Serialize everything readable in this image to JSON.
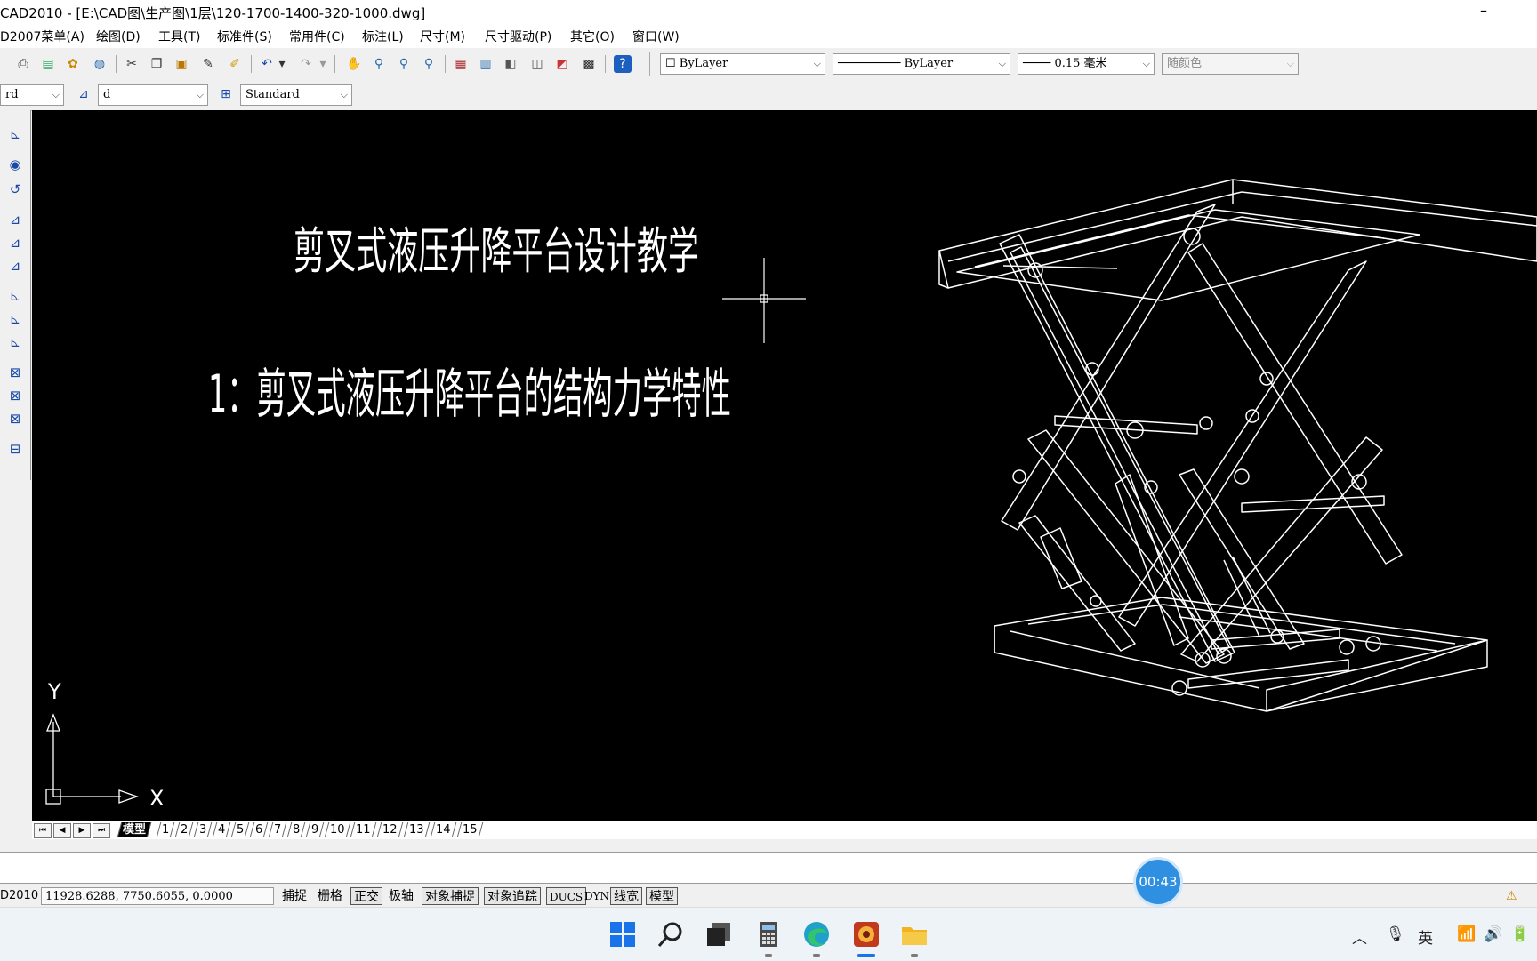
{
  "window": {
    "title": "CAD2010 - [E:\\CAD图\\生产图\\1层\\120-1700-1400-320-1000.dwg]",
    "minimize_glyph": "–"
  },
  "menu": [
    "D2007菜单(A)",
    "绘图(D)",
    "工具(T)",
    "标准件(S)",
    "常用件(C)",
    "标注(L)",
    "尺寸(M)",
    "尺寸驱动(P)",
    "其它(O)",
    "窗口(W)"
  ],
  "properties": {
    "layer_color": "ByLayer",
    "linetype": "ByLayer",
    "lineweight": "0.15 毫米",
    "plot_color": "随颜色"
  },
  "styles": {
    "text_style": "rd",
    "dim_style": "d",
    "table_style": "Standard"
  },
  "drawing": {
    "heading": "剪叉式液压升降平台设计教学",
    "subheading": "1：剪叉式液压升降平台的结构力学特性",
    "ucs_x": "X",
    "ucs_y": "Y"
  },
  "layout_tabs": [
    "模型",
    "1",
    "2",
    "3",
    "4",
    "5",
    "6",
    "7",
    "8",
    "9",
    "10",
    "11",
    "12",
    "13",
    "14",
    "15"
  ],
  "status": {
    "app_label": "D2010",
    "coordinates": "11928.6288, 7750.6055, 0.0000",
    "toggles": [
      {
        "label": "捕捉",
        "on": false
      },
      {
        "label": "栅格",
        "on": false
      },
      {
        "label": "正交",
        "on": true
      },
      {
        "label": "极轴",
        "on": false
      },
      {
        "label": "对象捕捉",
        "on": true
      },
      {
        "label": "对象追踪",
        "on": true
      },
      {
        "label": "DUCS",
        "on": true
      },
      {
        "label": "DYN",
        "on": false
      },
      {
        "label": "线宽",
        "on": true
      },
      {
        "label": "模型",
        "on": true
      }
    ]
  },
  "recording_timer": "00:43",
  "taskbar": {
    "tray_ime": "英",
    "icons": [
      "start-icon",
      "search-icon",
      "task-view-icon",
      "calculator-icon",
      "edge-icon",
      "cad-app-icon",
      "file-explorer-icon"
    ]
  },
  "colors": {
    "canvas": "#000000",
    "drawing_lines": "#ffffff",
    "timer": "#2f8fe0",
    "toolbar_bg": "#f0f0f0"
  }
}
